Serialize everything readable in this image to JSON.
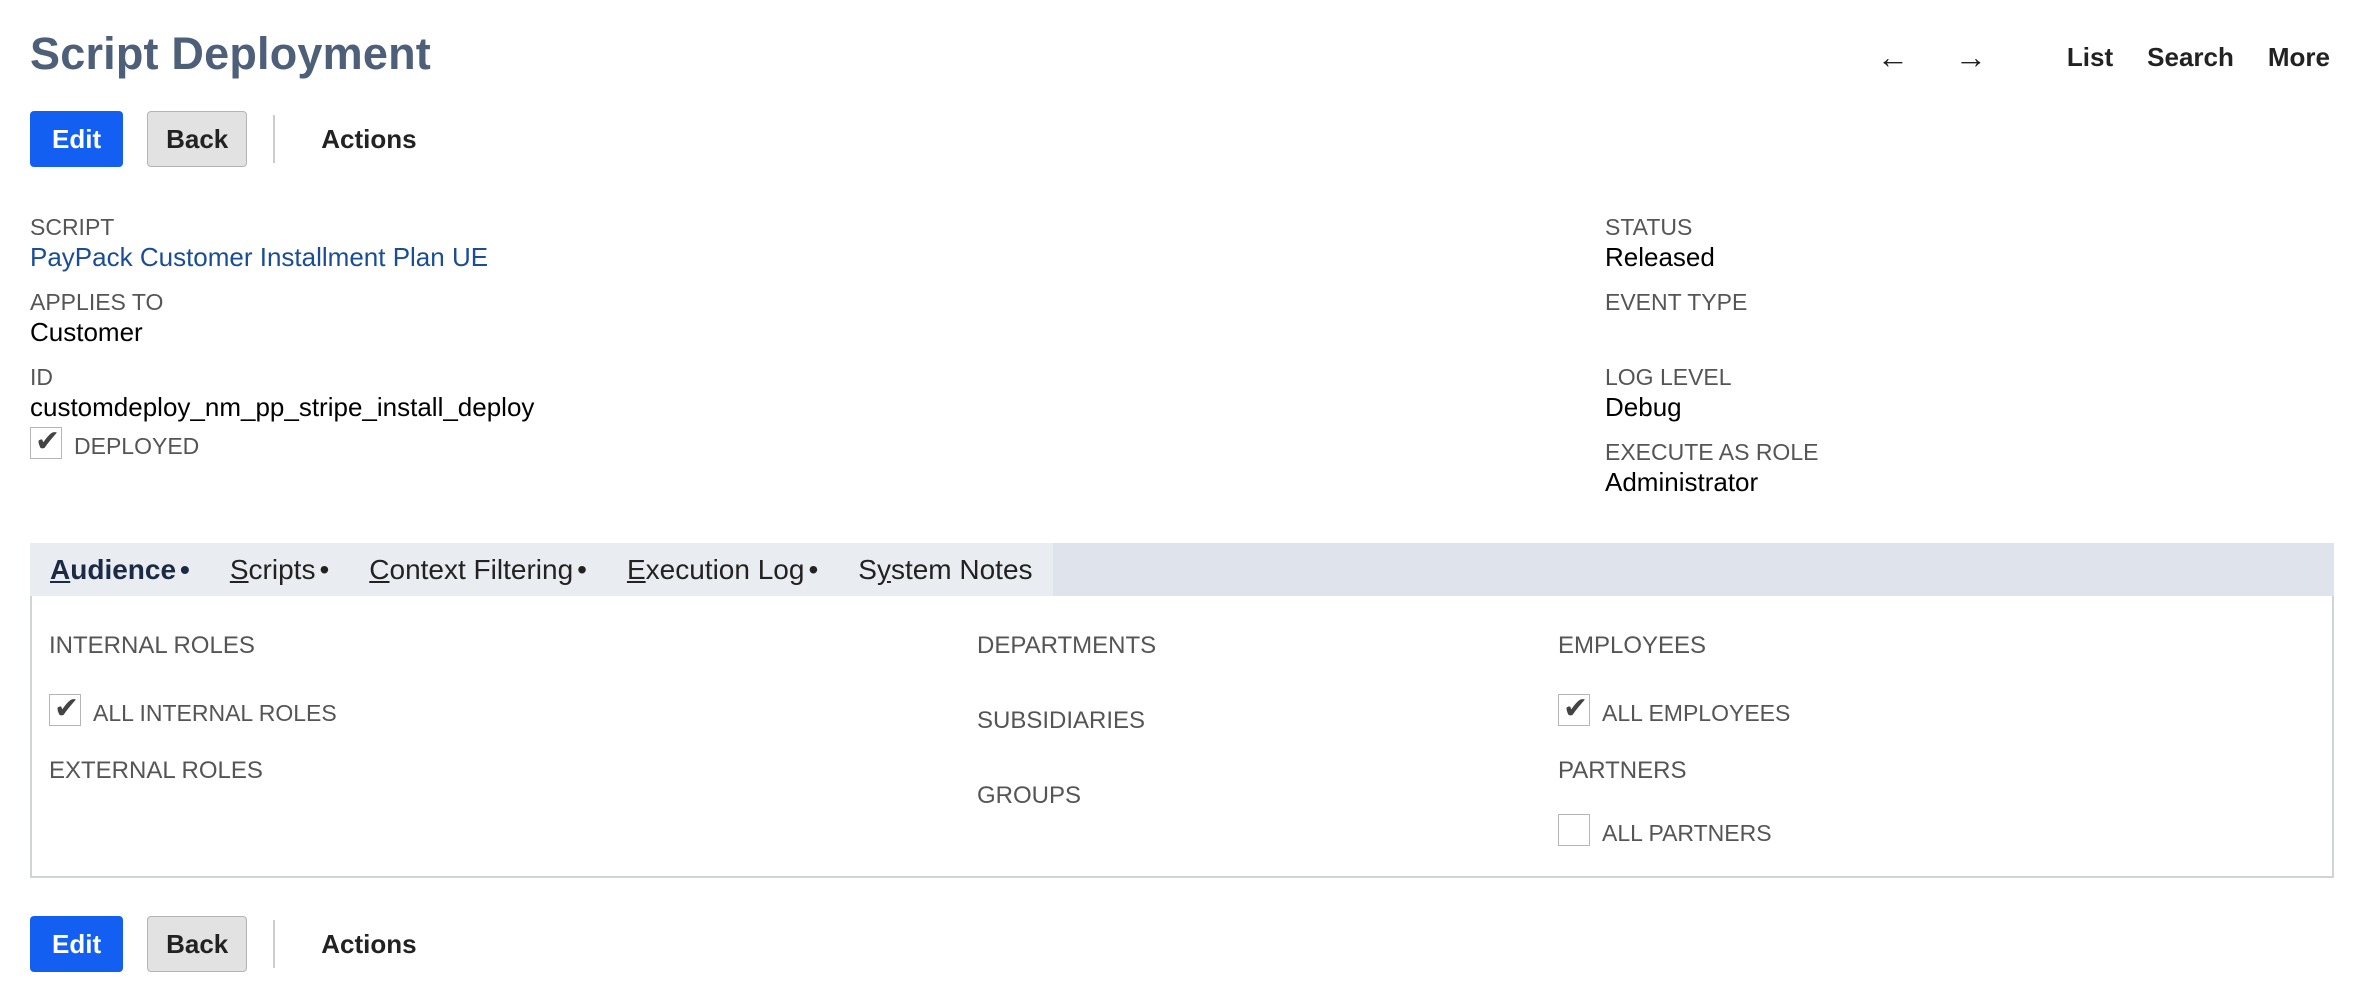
{
  "page": {
    "title": "Script Deployment"
  },
  "topnav": {
    "back_arrow": "←",
    "forward_arrow": "→",
    "list": "List",
    "search": "Search",
    "more": "More"
  },
  "buttons": {
    "edit": "Edit",
    "back": "Back",
    "actions": "Actions"
  },
  "fields": {
    "script": {
      "label": "SCRIPT",
      "value": "PayPack Customer Installment Plan UE"
    },
    "applies_to": {
      "label": "APPLIES TO",
      "value": "Customer"
    },
    "id": {
      "label": "ID",
      "value": "customdeploy_nm_pp_stripe_install_deploy"
    },
    "deployed": {
      "label": "DEPLOYED",
      "checked": true
    },
    "status": {
      "label": "STATUS",
      "value": "Released"
    },
    "event_type": {
      "label": "EVENT TYPE",
      "value": ""
    },
    "log_level": {
      "label": "LOG LEVEL",
      "value": "Debug"
    },
    "execute_as_role": {
      "label": "EXECUTE AS ROLE",
      "value": "Administrator"
    }
  },
  "tabs": [
    {
      "key": "A",
      "rest": "udience",
      "bullet": "•",
      "active": true
    },
    {
      "key": "S",
      "rest": "cripts",
      "bullet": "•",
      "active": false
    },
    {
      "key": "C",
      "rest": "ontext Filtering",
      "bullet": "•",
      "active": false
    },
    {
      "key": "E",
      "rest": "xecution Log",
      "bullet": "•",
      "active": false
    },
    {
      "pre": "S",
      "key": "y",
      "rest": "stem Notes",
      "bullet": "",
      "active": false
    }
  ],
  "audience": {
    "internal_roles": "INTERNAL ROLES",
    "all_internal_roles": {
      "label": "ALL INTERNAL ROLES",
      "checked": true
    },
    "external_roles": "EXTERNAL ROLES",
    "departments": "DEPARTMENTS",
    "subsidiaries": "SUBSIDIARIES",
    "groups": "GROUPS",
    "employees": "EMPLOYEES",
    "all_employees": {
      "label": "ALL EMPLOYEES",
      "checked": true
    },
    "partners": "PARTNERS",
    "all_partners": {
      "label": "ALL PARTNERS",
      "checked": false
    }
  },
  "icons": {
    "checkmark": "✔"
  }
}
